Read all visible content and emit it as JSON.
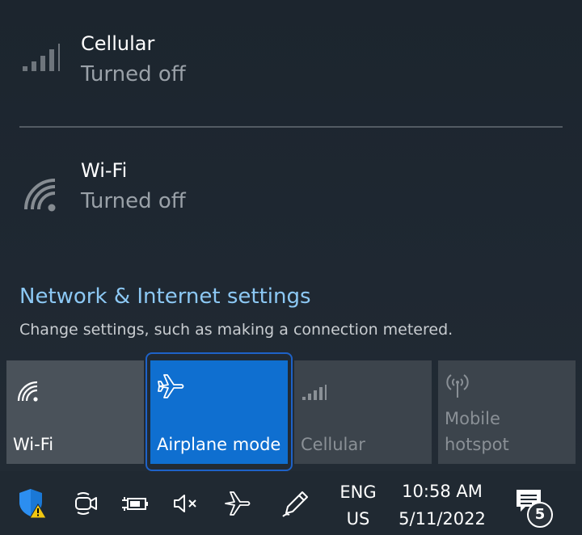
{
  "networks": [
    {
      "name": "Cellular",
      "status": "Turned off",
      "icon": "cellular-signal-icon"
    },
    {
      "name": "Wi-Fi",
      "status": "Turned off",
      "icon": "wifi-icon"
    }
  ],
  "settings": {
    "link": "Network & Internet settings",
    "description": "Change settings, such as making a connection metered."
  },
  "quick_actions": [
    {
      "label": "Wi-Fi",
      "state": "off",
      "icon": "wifi-icon"
    },
    {
      "label": "Airplane mode",
      "state": "on",
      "icon": "airplane-icon"
    },
    {
      "label": "Cellular",
      "state": "disabled",
      "icon": "cellular-signal-icon"
    },
    {
      "label": "Mobile\nhotspot",
      "state": "disabled",
      "icon": "hotspot-icon"
    }
  ],
  "taskbar": {
    "icons": [
      "security-warning-icon",
      "meet-now-icon",
      "battery-charging-icon",
      "volume-muted-icon",
      "airplane-icon",
      "pen-icon"
    ],
    "language": {
      "line1": "ENG",
      "line2": "US"
    },
    "clock": {
      "time": "10:58 AM",
      "date": "5/11/2022"
    },
    "notifications": {
      "count": "5"
    }
  },
  "colors": {
    "accent": "#0f6fd0",
    "link": "#8cc8f4",
    "focus": "#1e62c8",
    "warning": "#f2c811"
  }
}
